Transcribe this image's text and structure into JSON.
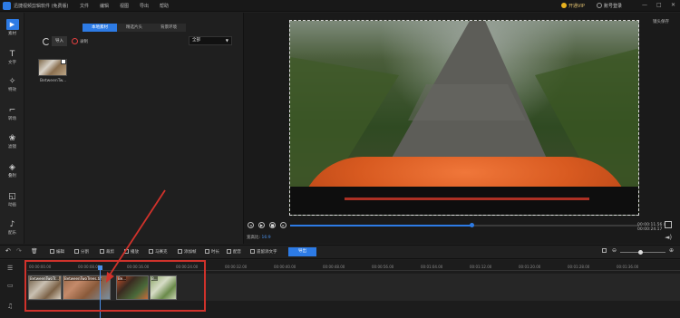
{
  "app": {
    "title": "迅捷视频剪辑软件 (免费版)"
  },
  "menu": [
    "文件",
    "编辑",
    "视图",
    "导出",
    "帮助"
  ],
  "account": {
    "vip_label": "开通VIP",
    "login_label": "账号登录"
  },
  "window_controls": [
    "—",
    "□",
    "✕"
  ],
  "sidebar": {
    "items": [
      {
        "label": "素材",
        "icon": "media-icon",
        "active": true
      },
      {
        "label": "文字",
        "icon": "text-icon"
      },
      {
        "label": "特效",
        "icon": "effects-icon"
      },
      {
        "label": "转场",
        "icon": "transition-icon"
      },
      {
        "label": "滤镜",
        "icon": "filter-icon"
      },
      {
        "label": "叠附",
        "icon": "overlay-icon"
      },
      {
        "label": "动画",
        "icon": "animation-icon"
      },
      {
        "label": "配乐",
        "icon": "music-icon"
      }
    ]
  },
  "media": {
    "tabs": [
      "本地素材",
      "精选片头",
      "背景环境"
    ],
    "active_tab": 0,
    "import_label": "导入",
    "record_label": "录制",
    "filter_value": "全部",
    "items": [
      {
        "name": "BetweenTw..."
      }
    ]
  },
  "preview": {
    "snapshot_label": "镜头保存",
    "timecode": "00:00:11.56 / 00:00:24.17",
    "ratio_label": "宽高比:",
    "ratio_value": "16:9",
    "progress": 0.52
  },
  "toolbar": {
    "undo": "↶",
    "redo": "↷",
    "delete": "🗑",
    "items": [
      "编辑",
      "分割",
      "裁剪",
      "播放",
      "马赛克",
      "添加帧",
      "时长",
      "配音",
      "遗留添文字"
    ],
    "export_label": "导出",
    "zoom": 0.4
  },
  "timeline": {
    "ticks": [
      "00:00:00.00",
      "00:00:08.00",
      "00:00:16.00",
      "00:00:24.00",
      "00:00:32.00",
      "00:00:40.00",
      "00:00:48.00",
      "00:00:56.00",
      "00:01:04.00",
      "00:01:12.00",
      "00:01:20.00",
      "00:01:28.00",
      "00:01:36.00",
      "00:01:44.00",
      "00:01:52.00"
    ],
    "clips": [
      {
        "label": "BetweenTwoTr..."
      },
      {
        "label": "BetweenTwoTrees.tif"
      },
      {
        "label": "Be..."
      },
      {
        "label": "B..."
      }
    ]
  },
  "colors": {
    "accent": "#2d7be5",
    "annotation": "#d0322b"
  }
}
